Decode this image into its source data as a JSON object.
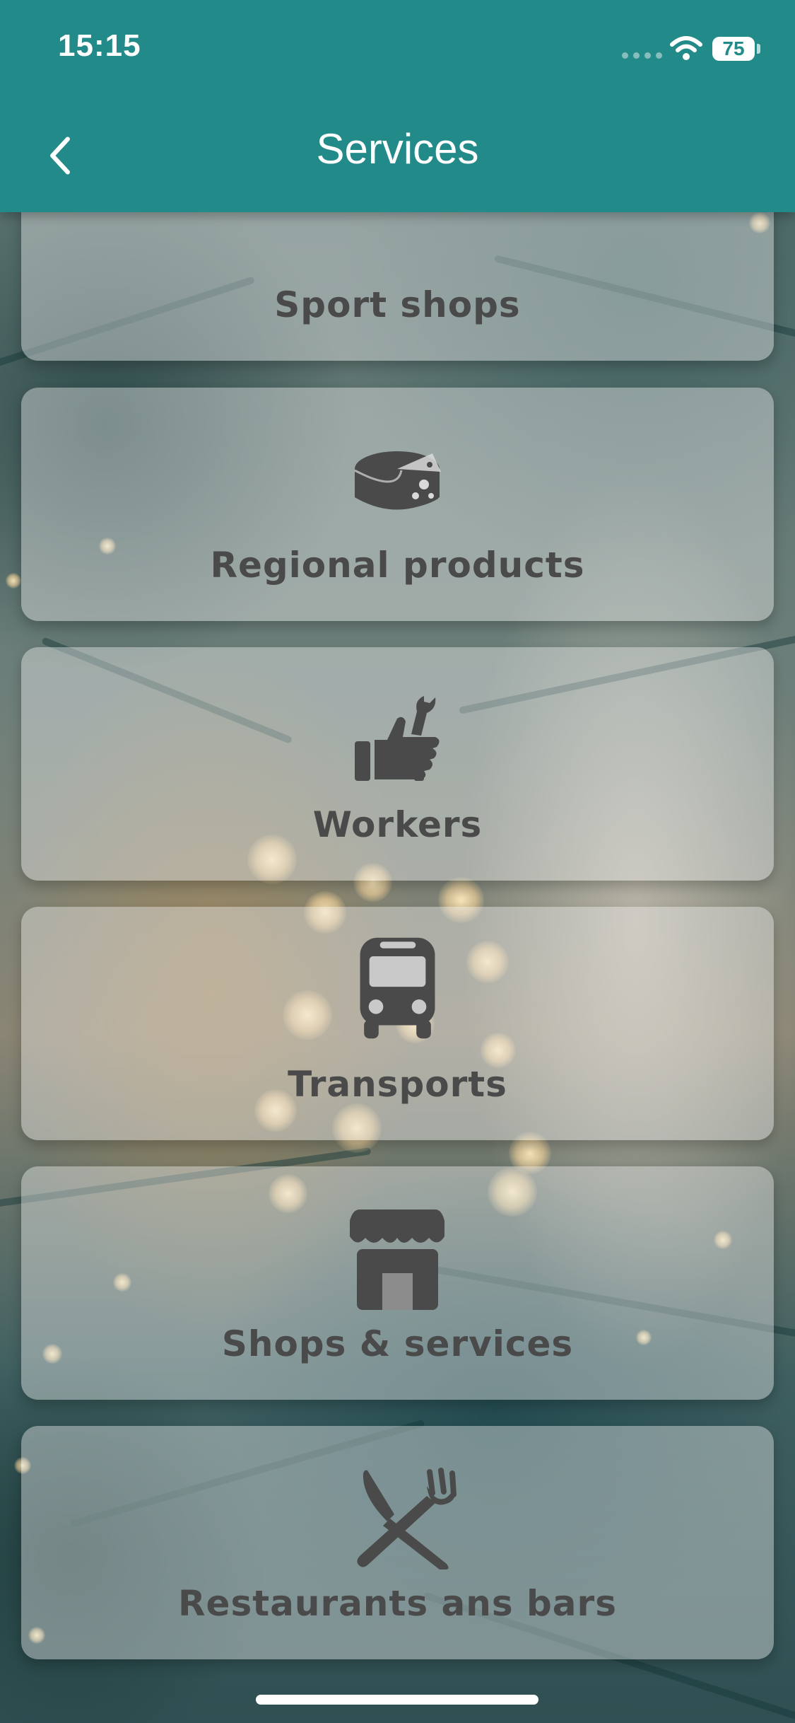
{
  "status_bar": {
    "time": "15:15",
    "battery_level": "75",
    "icons": [
      "cellular-signal-icon",
      "wifi-icon",
      "battery-icon"
    ]
  },
  "header": {
    "title": "Services",
    "back_icon": "chevron-left-icon",
    "background_color": "#228a88"
  },
  "services": [
    {
      "label": "Sport shops",
      "icon": "sport-shops-icon"
    },
    {
      "label": "Regional products",
      "icon": "cheese-icon"
    },
    {
      "label": "Workers",
      "icon": "worker-wrench-icon"
    },
    {
      "label": "Transports",
      "icon": "bus-icon"
    },
    {
      "label": "Shops & services",
      "icon": "storefront-icon"
    },
    {
      "label": "Restaurants ans bars",
      "icon": "knife-fork-icon"
    }
  ],
  "colors": {
    "card_text": "#4a4a4a",
    "icon": "#4a4a4a"
  }
}
